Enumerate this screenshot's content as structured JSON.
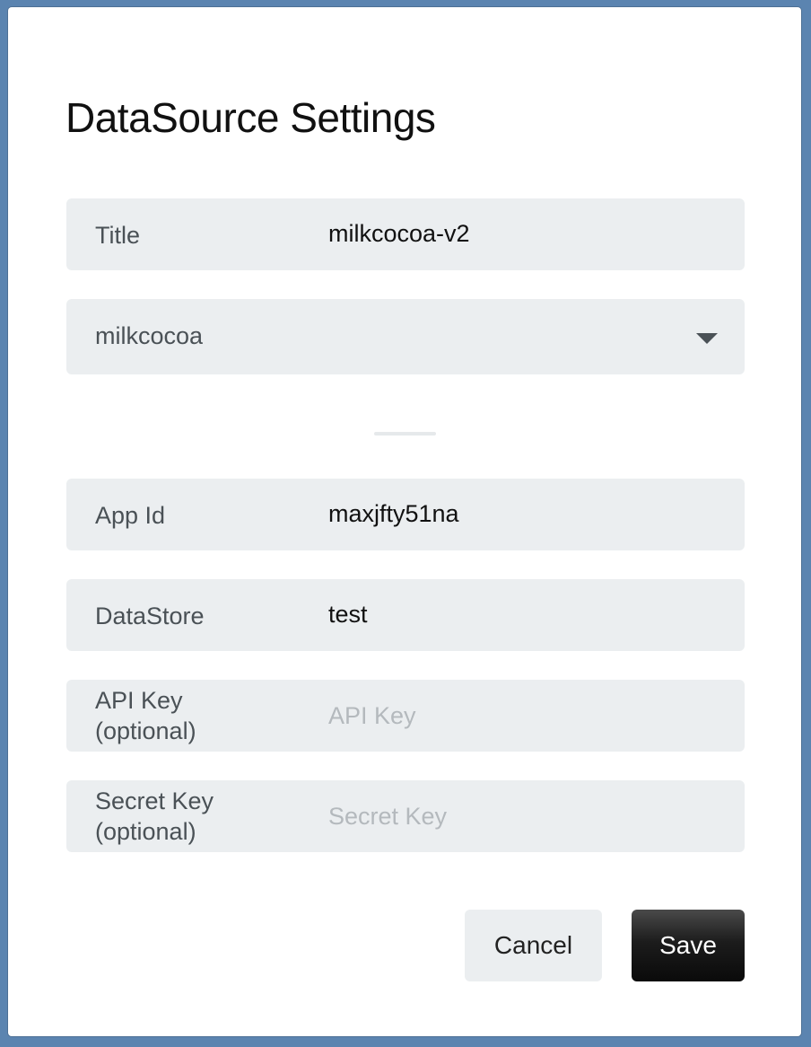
{
  "dialog": {
    "title": "DataSource Settings"
  },
  "fields": {
    "title": {
      "label": "Title",
      "value": "milkcocoa-v2"
    },
    "type_select": {
      "value": "milkcocoa"
    },
    "app_id": {
      "label": "App Id",
      "value": "maxjfty51na"
    },
    "datastore": {
      "label": "DataStore",
      "value": "test"
    },
    "api_key": {
      "label_line1": "API Key",
      "label_line2": "(optional)",
      "placeholder": "API Key"
    },
    "secret_key": {
      "label_line1": "Secret Key",
      "label_line2": "(optional)",
      "placeholder": "Secret Key"
    }
  },
  "buttons": {
    "cancel": "Cancel",
    "save": "Save"
  },
  "icons": {
    "select_caret": "chevron-down-icon"
  },
  "colors": {
    "field_background": "#ebeef0",
    "save_button": "#1c1c1c",
    "backdrop": "#5b84b0"
  }
}
